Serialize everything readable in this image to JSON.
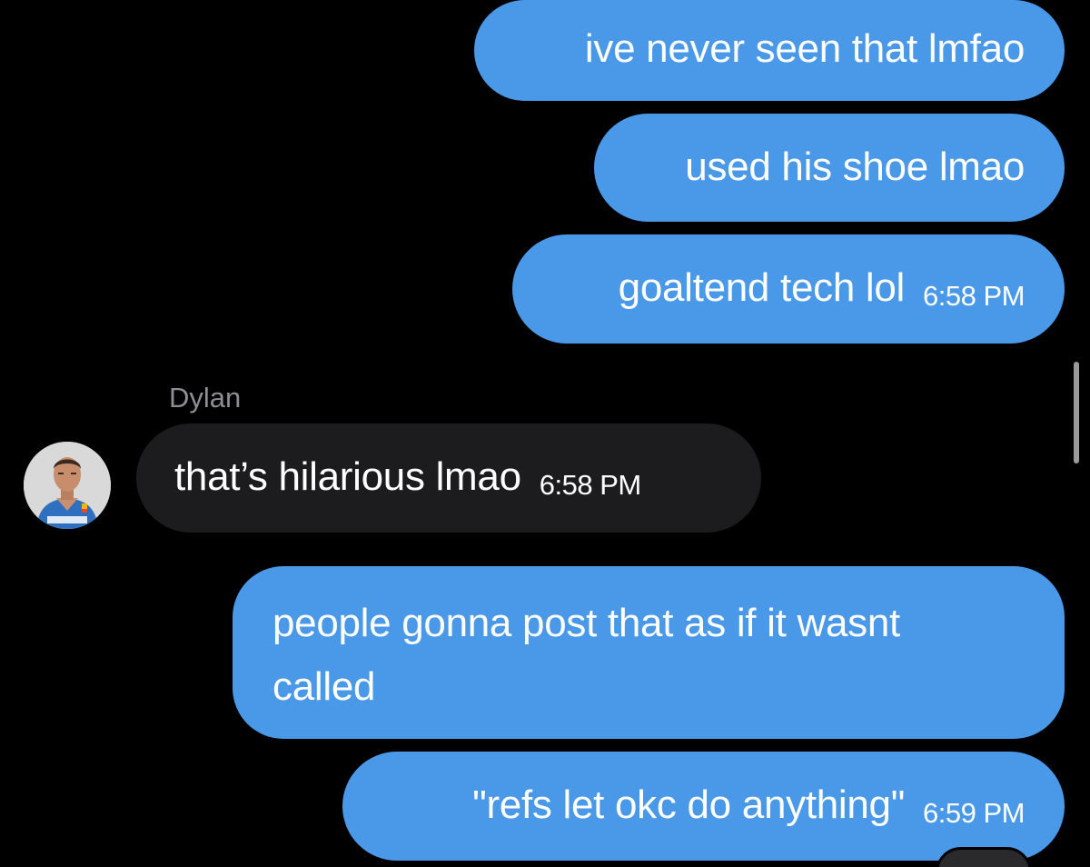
{
  "conversation": {
    "colors": {
      "outgoing_bubble": "#4a98e8",
      "incoming_bubble": "#1c1c1e",
      "background": "#000000",
      "sender_name": "#8e8e93"
    },
    "messages": [
      {
        "direction": "outgoing",
        "text": "ive never seen that lmfao",
        "time": ""
      },
      {
        "direction": "outgoing",
        "text": "used his shoe lmao",
        "time": ""
      },
      {
        "direction": "outgoing",
        "text": "goaltend tech lol",
        "time": "6:58 PM"
      },
      {
        "direction": "incoming",
        "sender": "Dylan",
        "text": "that’s hilarious lmao",
        "time": "6:58 PM"
      },
      {
        "direction": "outgoing",
        "text_line1": "people gonna post that as if it wasnt",
        "text_line2": "called",
        "time": ""
      },
      {
        "direction": "outgoing",
        "text": "\"refs let okc do anything\"",
        "time": "6:59 PM"
      }
    ]
  }
}
